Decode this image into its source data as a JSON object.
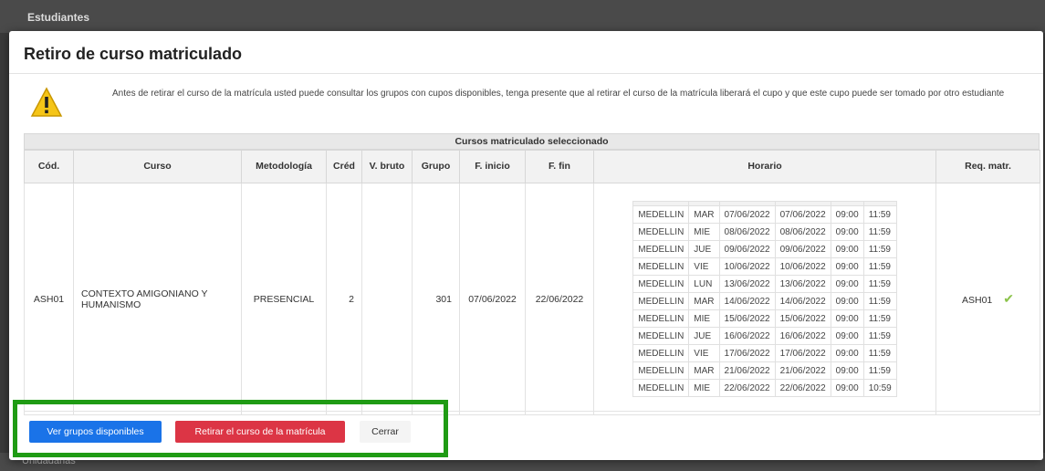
{
  "background": {
    "header_label": "Estudiantes",
    "footer_label": "Unidadanas"
  },
  "modal": {
    "title": "Retiro de curso matriculado",
    "warning_text": "Antes de retirar el curso de la matrícula usted puede consultar los grupos con cupos disponibles, tenga presente que al retirar el curso de la matrícula liberará el cupo y que este cupo puede ser tomado por otro estudiante",
    "icon": "warning-icon"
  },
  "table": {
    "caption": "Cursos matriculado seleccionado",
    "headers": {
      "cod": "Cód.",
      "curso": "Curso",
      "metodologia": "Metodología",
      "cred": "Créd",
      "vbruto": "V. bruto",
      "grupo": "Grupo",
      "finicio": "F. inicio",
      "ffin": "F. fin",
      "horario": "Horario",
      "req": "Req. matr."
    },
    "row": {
      "cod": "ASH01",
      "curso": "CONTEXTO AMIGONIANO Y HUMANISMO",
      "metodologia": "PRESENCIAL",
      "cred": "2",
      "vbruto": "",
      "grupo": "301",
      "finicio": "07/06/2022",
      "ffin": "22/06/2022",
      "req": "ASH01",
      "req_icon": "check-icon"
    },
    "schedule": [
      [
        "MEDELLIN",
        "MAR",
        "07/06/2022",
        "07/06/2022",
        "09:00",
        "11:59"
      ],
      [
        "MEDELLIN",
        "MIE",
        "08/06/2022",
        "08/06/2022",
        "09:00",
        "11:59"
      ],
      [
        "MEDELLIN",
        "JUE",
        "09/06/2022",
        "09/06/2022",
        "09:00",
        "11:59"
      ],
      [
        "MEDELLIN",
        "VIE",
        "10/06/2022",
        "10/06/2022",
        "09:00",
        "11:59"
      ],
      [
        "MEDELLIN",
        "LUN",
        "13/06/2022",
        "13/06/2022",
        "09:00",
        "11:59"
      ],
      [
        "MEDELLIN",
        "MAR",
        "14/06/2022",
        "14/06/2022",
        "09:00",
        "11:59"
      ],
      [
        "MEDELLIN",
        "MIE",
        "15/06/2022",
        "15/06/2022",
        "09:00",
        "11:59"
      ],
      [
        "MEDELLIN",
        "JUE",
        "16/06/2022",
        "16/06/2022",
        "09:00",
        "11:59"
      ],
      [
        "MEDELLIN",
        "VIE",
        "17/06/2022",
        "17/06/2022",
        "09:00",
        "11:59"
      ],
      [
        "MEDELLIN",
        "MAR",
        "21/06/2022",
        "21/06/2022",
        "09:00",
        "11:59"
      ],
      [
        "MEDELLIN",
        "MIE",
        "22/06/2022",
        "22/06/2022",
        "09:00",
        "10:59"
      ]
    ]
  },
  "buttons": {
    "ver_grupos": "Ver grupos disponibles",
    "retirar": "Retirar el curso de la matrícula",
    "cerrar": "Cerrar"
  },
  "colors": {
    "primary": "#1a73e8",
    "danger": "#dc3545",
    "highlight": "#1f9b14",
    "check": "#8bc34a"
  }
}
